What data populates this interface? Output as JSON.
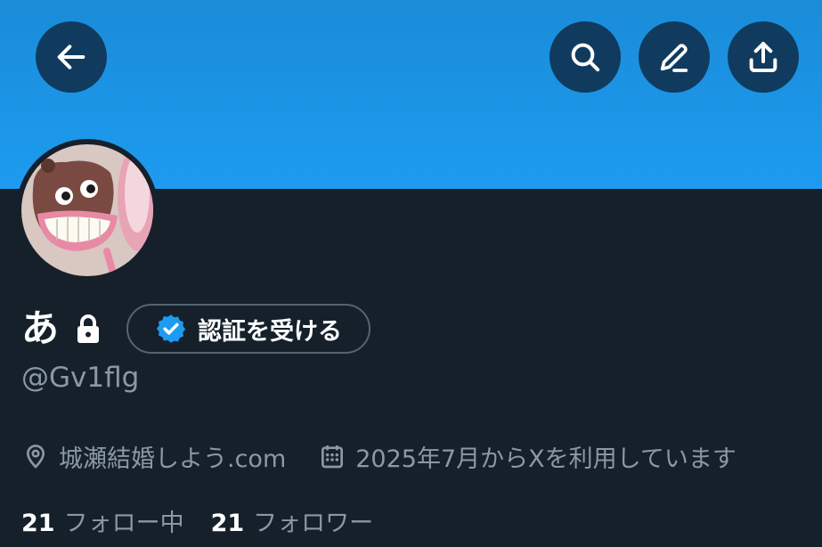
{
  "profile": {
    "display_name": "あ",
    "handle": "@Gv1flg",
    "verify_label": "認証を受ける",
    "website": "城瀬結婚しよう.com",
    "joined": "2025年7月からXを利用しています",
    "following_count": "21",
    "following_label": "フォロー中",
    "followers_count": "21",
    "followers_label": "フォロワー"
  },
  "icons": {
    "back": "back-arrow-icon",
    "search": "search-icon",
    "edit": "edit-pencil-icon",
    "share": "share-upload-icon",
    "lock": "lock-icon",
    "verified": "verified-badge-icon",
    "location": "location-pin-icon",
    "calendar": "calendar-icon"
  },
  "colors": {
    "banner": "#1d9bf0",
    "background": "#15202b",
    "secondary_text": "#8b98a5",
    "verified_blue": "#1d9bf0",
    "button_border": "#536471"
  }
}
